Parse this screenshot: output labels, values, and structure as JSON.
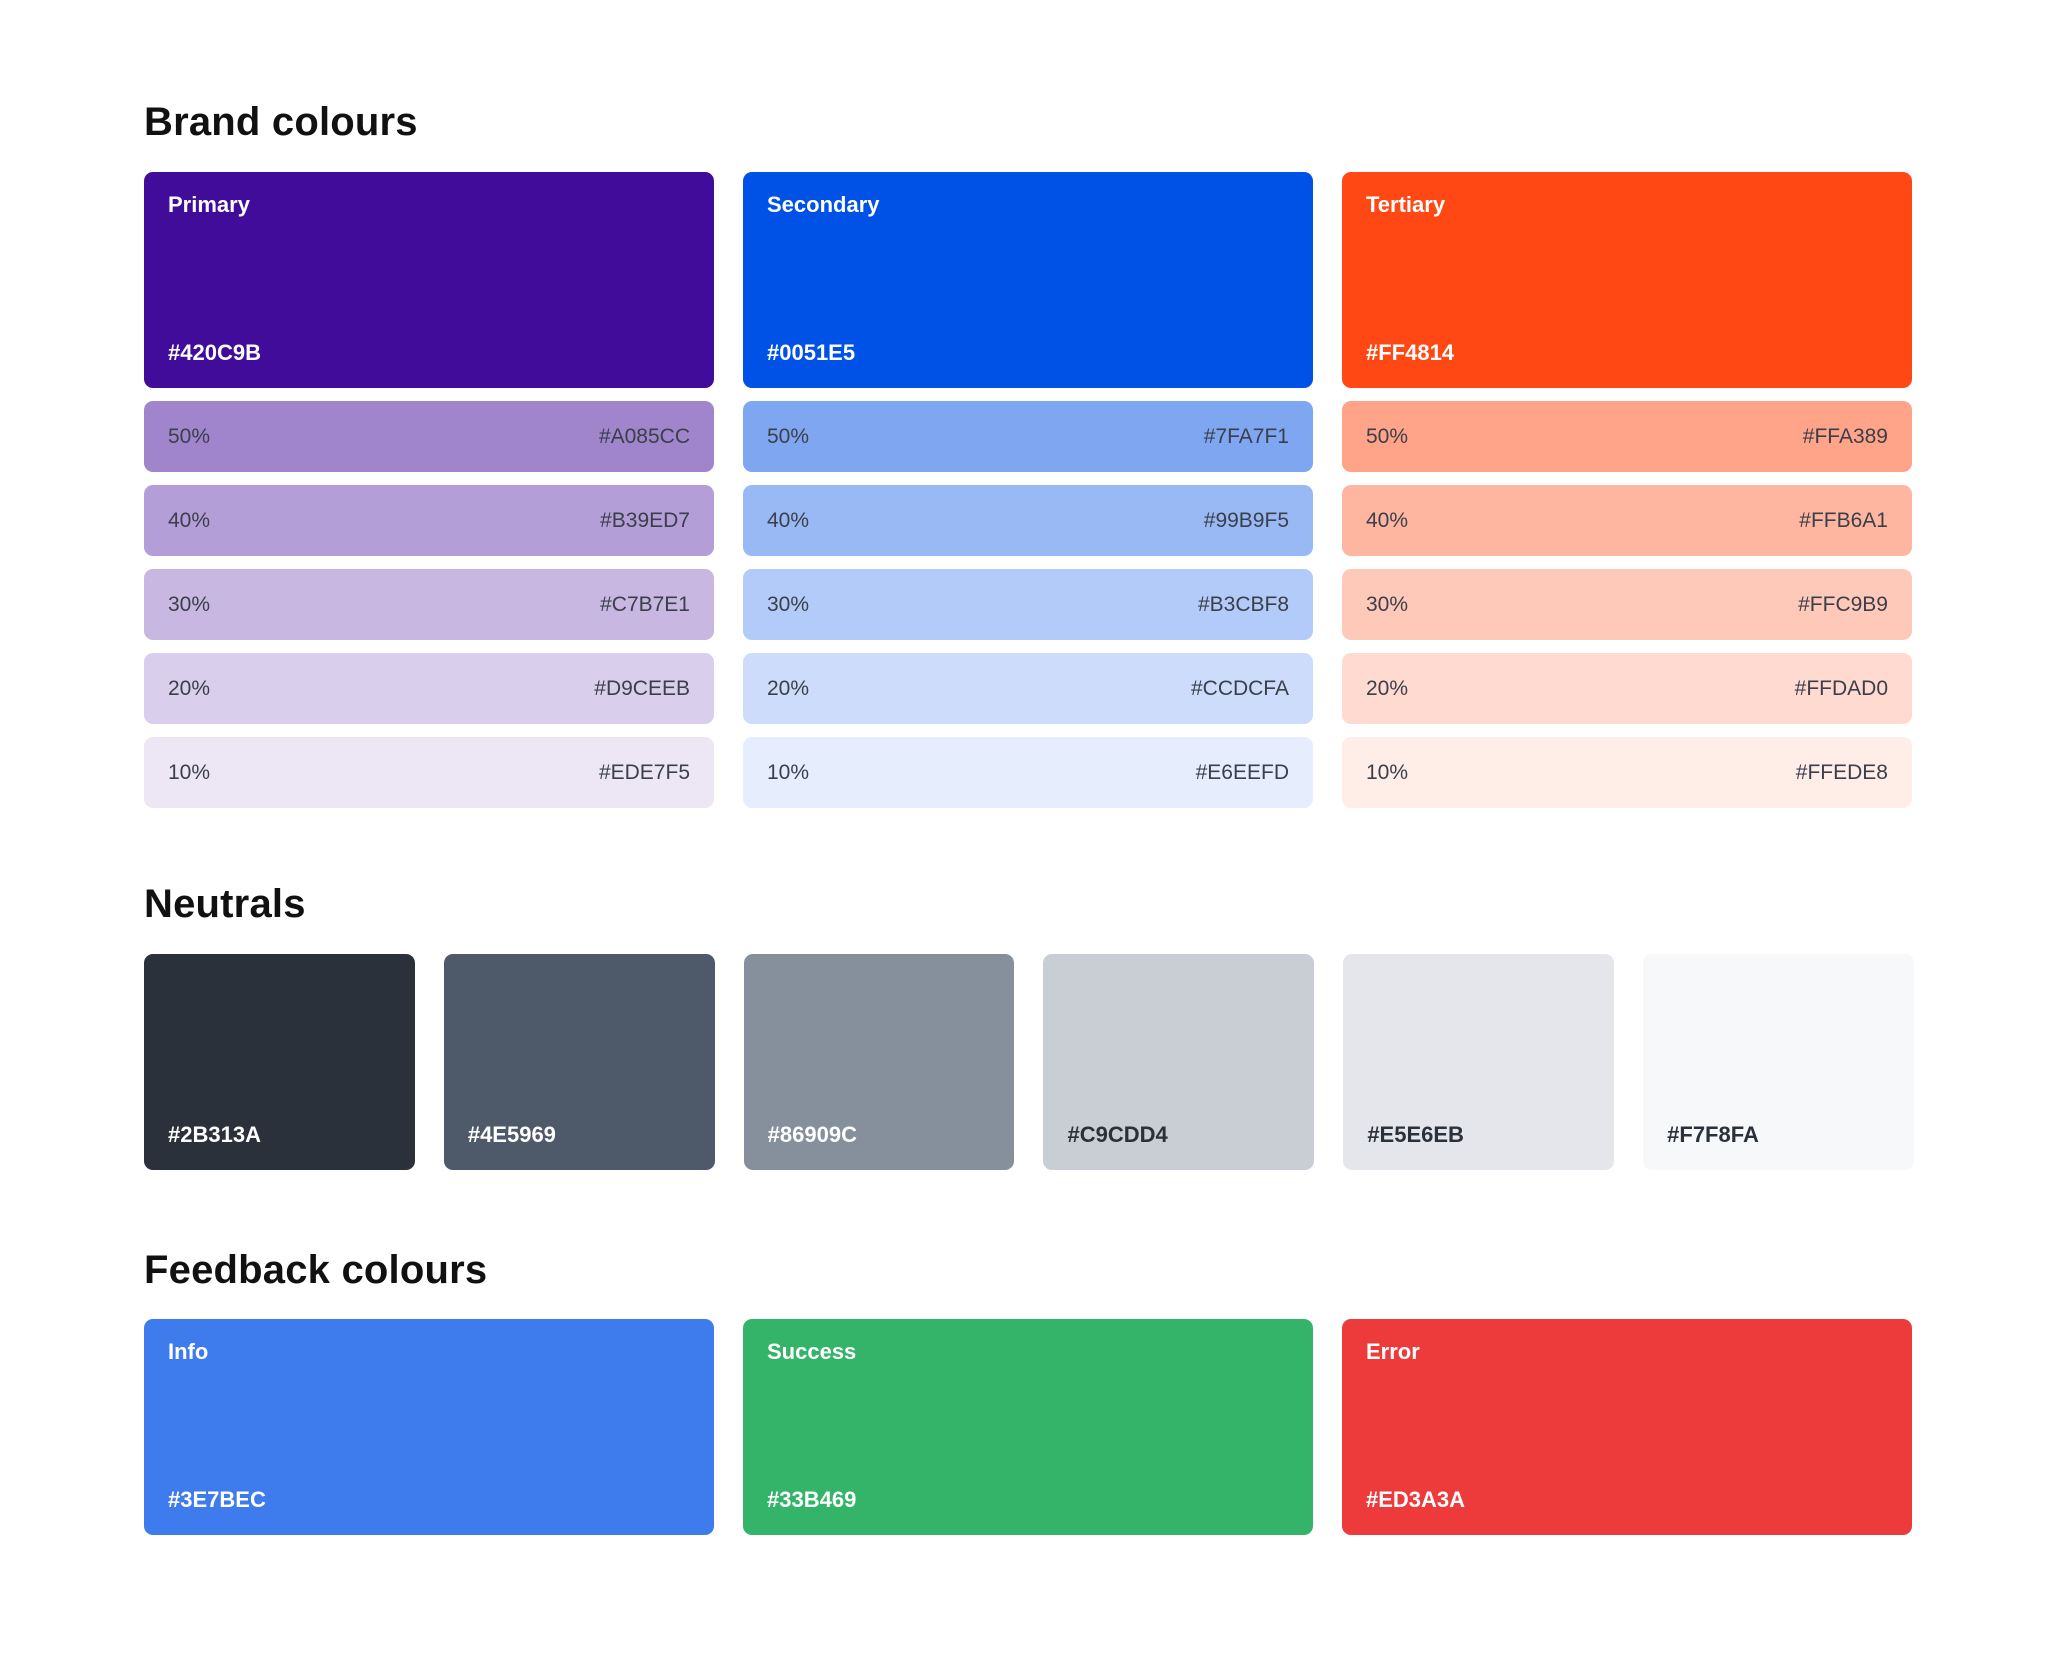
{
  "brand": {
    "title": "Brand colours",
    "columns": [
      {
        "name": "Primary",
        "hex": "#420C9B",
        "color": "#420C9B",
        "tints": [
          {
            "percent": "50%",
            "hex": "#A085CC",
            "color": "#A085CC"
          },
          {
            "percent": "40%",
            "hex": "#B39ED7",
            "color": "#B39ED7"
          },
          {
            "percent": "30%",
            "hex": "#C7B7E1",
            "color": "#C7B7E1"
          },
          {
            "percent": "20%",
            "hex": "#D9CEEB",
            "color": "#D9CEEB"
          },
          {
            "percent": "10%",
            "hex": "#EDE7F5",
            "color": "#EDE7F5"
          }
        ]
      },
      {
        "name": "Secondary",
        "hex": "#0051E5",
        "color": "#0051E5",
        "tints": [
          {
            "percent": "50%",
            "hex": "#7FA7F1",
            "color": "#7FA7F1"
          },
          {
            "percent": "40%",
            "hex": "#99B9F5",
            "color": "#99B9F5"
          },
          {
            "percent": "30%",
            "hex": "#B3CBF8",
            "color": "#B3CBF8"
          },
          {
            "percent": "20%",
            "hex": "#CCDCFA",
            "color": "#CCDCFA"
          },
          {
            "percent": "10%",
            "hex": "#E6EEFD",
            "color": "#E6EEFD"
          }
        ]
      },
      {
        "name": "Tertiary",
        "hex": "#FF4814",
        "color": "#FF4814",
        "tints": [
          {
            "percent": "50%",
            "hex": "#FFA389",
            "color": "#FFA389"
          },
          {
            "percent": "40%",
            "hex": "#FFB6A1",
            "color": "#FFB6A1"
          },
          {
            "percent": "30%",
            "hex": "#FFC9B9",
            "color": "#FFC9B9"
          },
          {
            "percent": "20%",
            "hex": "#FFDAD0",
            "color": "#FFDAD0"
          },
          {
            "percent": "10%",
            "hex": "#FFEDE8",
            "color": "#FFEDE8"
          }
        ]
      }
    ]
  },
  "neutrals": {
    "title": "Neutrals",
    "swatches": [
      {
        "hex": "#2B313A",
        "color": "#2B313A",
        "text_color": "#FFFFFF"
      },
      {
        "hex": "#4E5969",
        "color": "#4E5969",
        "text_color": "#FFFFFF"
      },
      {
        "hex": "#86909C",
        "color": "#86909C",
        "text_color": "#FFFFFF"
      },
      {
        "hex": "#C9CDD4",
        "color": "#C9CDD4",
        "text_color": "#2B313A"
      },
      {
        "hex": "#E5E6EB",
        "color": "#E5E6EB",
        "text_color": "#2B313A"
      },
      {
        "hex": "#F7F8FA",
        "color": "#F7F8FA",
        "text_color": "#2B313A"
      }
    ]
  },
  "feedback": {
    "title": "Feedback colours",
    "swatches": [
      {
        "name": "Info",
        "hex": "#3E7BEC",
        "color": "#3E7BEC"
      },
      {
        "name": "Success",
        "hex": "#33B469",
        "color": "#33B469"
      },
      {
        "name": "Error",
        "hex": "#ED3A3A",
        "color": "#ED3A3A"
      }
    ]
  }
}
